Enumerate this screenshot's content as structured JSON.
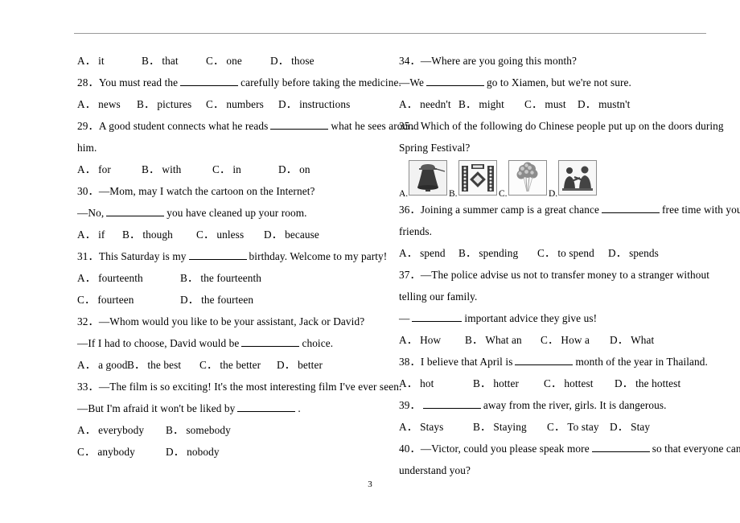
{
  "page": {
    "number": "3",
    "header_rule": true
  },
  "left_column": [
    {
      "type": "options",
      "items": [
        {
          "label": "A．",
          "text": "it"
        },
        {
          "label": "B．",
          "text": "that"
        },
        {
          "label": "C．",
          "text": "one"
        },
        {
          "label": "D．",
          "text": "those"
        }
      ],
      "tabs": [
        0,
        80,
        160,
        240
      ]
    },
    {
      "type": "question",
      "number": "28．",
      "pre": "You must read the",
      "blank": "long",
      "post": "carefully before taking the medicine."
    },
    {
      "type": "options",
      "items": [
        {
          "label": "A．",
          "text": "news"
        },
        {
          "label": "B．",
          "text": "pictures"
        },
        {
          "label": "C．",
          "text": "numbers"
        },
        {
          "label": "D．",
          "text": "instructions"
        }
      ],
      "tabs": [
        0,
        74,
        160,
        250
      ]
    },
    {
      "type": "question",
      "number": "29．",
      "pre": "A good student connects what he reads",
      "blank": "long",
      "post": "what he sees around"
    },
    {
      "type": "cont",
      "text": "him."
    },
    {
      "type": "options",
      "items": [
        {
          "label": "A．",
          "text": "for"
        },
        {
          "label": "B．",
          "text": "with"
        },
        {
          "label": "C．",
          "text": "in"
        },
        {
          "label": "D．",
          "text": "on"
        }
      ],
      "tabs": [
        0,
        80,
        168,
        250
      ]
    },
    {
      "type": "question",
      "number": "30．",
      "text": "—Mom, may I watch the cartoon on the Internet?"
    },
    {
      "type": "dialog",
      "pre": "—No,",
      "blank": "long",
      "post": "you have cleaned up your room."
    },
    {
      "type": "options",
      "items": [
        {
          "label": "A．",
          "text": "if"
        },
        {
          "label": "B．",
          "text": "though"
        },
        {
          "label": "C．",
          "text": "unless"
        },
        {
          "label": "D．",
          "text": "because"
        }
      ],
      "tabs": [
        0,
        56,
        148,
        232
      ]
    },
    {
      "type": "question",
      "number": "31．",
      "pre": "This Saturday is my",
      "blank": "long",
      "post": "birthday. Welcome to my party!"
    },
    {
      "type": "options",
      "items": [
        {
          "label": "A．",
          "text": "fourteenth"
        },
        {
          "label": "B．",
          "text": "the fourteenth"
        }
      ],
      "tabs": [
        0,
        128
      ]
    },
    {
      "type": "options",
      "items": [
        {
          "label": "C．",
          "text": "fourteen"
        },
        {
          "label": "D．",
          "text": "the fourteen"
        }
      ],
      "tabs": [
        0,
        128
      ]
    },
    {
      "type": "question",
      "number": "32．",
      "text": "—Whom would you like to be your assistant, Jack or David?"
    },
    {
      "type": "dialog",
      "pre": "—If I had to choose, David would be",
      "blank": "long",
      "post": "choice."
    },
    {
      "type": "options",
      "items": [
        {
          "label": "A．",
          "text": "a good"
        },
        {
          "label": "B．",
          "text": "the best"
        },
        {
          "label": "C．",
          "text": "the better"
        },
        {
          "label": "D．",
          "text": "better"
        }
      ],
      "tabs": [
        0,
        62,
        152,
        248
      ]
    },
    {
      "type": "question",
      "number": "33．",
      "text": "—The film is so exciting! It's the most interesting film I've ever seen."
    },
    {
      "type": "dialog",
      "pre": "—But I'm afraid it won't be liked by",
      "blank": "long",
      "post": "."
    },
    {
      "type": "options",
      "items": [
        {
          "label": "A．",
          "text": "everybody"
        },
        {
          "label": "B．",
          "text": "somebody"
        }
      ],
      "tabs": [
        0,
        110
      ]
    },
    {
      "type": "options",
      "items": [
        {
          "label": "C．",
          "text": "anybody"
        },
        {
          "label": "D．",
          "text": "nobody"
        }
      ],
      "tabs": [
        0,
        110
      ]
    }
  ],
  "right_column": [
    {
      "type": "question",
      "number": "34．",
      "text": "—Where are you going this month?"
    },
    {
      "type": "dialog",
      "pre": "—We",
      "blank": "long",
      "post": "go to Xiamen, but we're not sure."
    },
    {
      "type": "options",
      "items": [
        {
          "label": "A．",
          "text": "needn't"
        },
        {
          "label": "B．",
          "text": "might"
        },
        {
          "label": "C．",
          "text": "must"
        },
        {
          "label": "D．",
          "text": "mustn't"
        }
      ],
      "tabs": [
        0,
        74,
        156,
        222
      ]
    },
    {
      "type": "question",
      "number": "35．",
      "text": "Which of the following do Chinese people put up on the doors during"
    },
    {
      "type": "cont",
      "text": "Spring Festival?"
    },
    {
      "type": "pictures",
      "items": [
        {
          "label": "A.",
          "name": "bell"
        },
        {
          "label": "B.",
          "name": "spring-festival-couplets"
        },
        {
          "label": "C.",
          "name": "balloons"
        },
        {
          "label": "D.",
          "name": "people-figures"
        }
      ]
    },
    {
      "type": "question",
      "number": "36．",
      "pre": "Joining a summer camp is a great chance",
      "blank": "long",
      "post": "free time with your"
    },
    {
      "type": "cont",
      "text": "friends."
    },
    {
      "type": "options",
      "items": [
        {
          "label": "A．",
          "text": "spend"
        },
        {
          "label": "B．",
          "text": "spending"
        },
        {
          "label": "C．",
          "text": "to spend"
        },
        {
          "label": "D．",
          "text": "spends"
        }
      ],
      "tabs": [
        0,
        74,
        172,
        260
      ]
    },
    {
      "type": "question",
      "number": "37．",
      "text": "—The police advise us not to transfer money to a stranger without"
    },
    {
      "type": "cont",
      "text": "telling our family."
    },
    {
      "type": "dialog",
      "pre": "—",
      "blank": "med",
      "post": "important advice they give us!"
    },
    {
      "type": "options",
      "items": [
        {
          "label": "A．",
          "text": "How"
        },
        {
          "label": "B．",
          "text": "What an"
        },
        {
          "label": "C．",
          "text": "How a"
        },
        {
          "label": "D．",
          "text": "What"
        }
      ],
      "tabs": [
        0,
        82,
        176,
        262
      ]
    },
    {
      "type": "question",
      "number": "38．",
      "pre": "I believe that April is",
      "blank": "long",
      "post": "month of the year in Thailand."
    },
    {
      "type": "options",
      "items": [
        {
          "label": "A．",
          "text": "hot"
        },
        {
          "label": "B．",
          "text": "hotter"
        },
        {
          "label": "C．",
          "text": "hottest"
        },
        {
          "label": "D．",
          "text": "the hottest"
        }
      ],
      "tabs": [
        0,
        92,
        180,
        268
      ]
    },
    {
      "type": "question",
      "number": "39．",
      "pre": "",
      "blank": "long",
      "post": "away from the river, girls. It is dangerous."
    },
    {
      "type": "options",
      "items": [
        {
          "label": "A．",
          "text": "Stays"
        },
        {
          "label": "B．",
          "text": "Staying"
        },
        {
          "label": "C．",
          "text": "To stay"
        },
        {
          "label": "D．",
          "text": "Stay"
        }
      ],
      "tabs": [
        0,
        92,
        184,
        262
      ]
    },
    {
      "type": "question",
      "number": "40．",
      "pre": "—Victor, could you please speak more",
      "blank": "long",
      "post": "so that everyone can"
    },
    {
      "type": "cont",
      "text": "understand you?"
    }
  ]
}
